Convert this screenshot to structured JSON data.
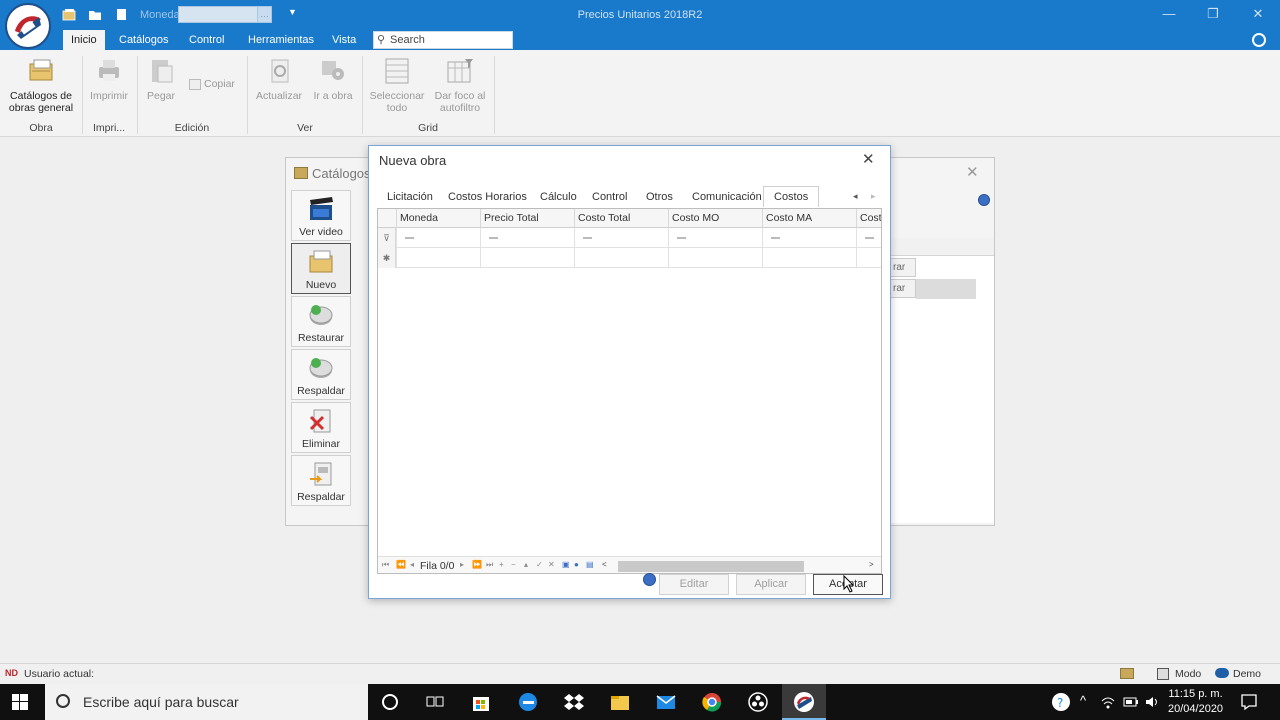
{
  "app": {
    "title": "Precios Unitarios 2018R2",
    "moneda_label": "Moneda"
  },
  "ribbon_tabs": [
    "Inicio",
    "Catálogos",
    "Control",
    "Herramientas",
    "Vista"
  ],
  "search_placeholder": "Search",
  "ribbon": {
    "obra_btn": "Catálogos de obras general",
    "imprimir_btn": "Imprimir",
    "pegar_btn": "Pegar",
    "copiar_btn": "Copiar",
    "actualizar_btn": "Actualizar",
    "ir_obra_btn": "Ir a obra",
    "seleccionar_btn": "Seleccionar todo",
    "dar_foco_btn": "Dar foco al autofiltro",
    "groups": [
      "Obra",
      "Impri...",
      "Edición",
      "Ver",
      "Grid"
    ]
  },
  "bg_window": {
    "title": "Catálogos",
    "side_buttons": [
      "Ver video",
      "Nuevo",
      "Restaurar",
      "Respaldar",
      "Eliminar",
      "Respaldar"
    ],
    "cell_buttons": [
      "rar",
      "rar"
    ]
  },
  "dialog": {
    "title": "Nueva obra",
    "tabs": [
      "Licitación",
      "Costos Horarios",
      "Cálculo",
      "Control",
      "Otros",
      "Comunicación",
      "Costos"
    ],
    "active_tab": "Costos",
    "columns": [
      "Moneda",
      "Precio Total",
      "Costo Total",
      "Costo MO",
      "Costo MA",
      "Costo"
    ],
    "nav_text": "Fila 0/0",
    "buttons": {
      "editar": "Editar",
      "aplicar": "Aplicar",
      "aceptar": "Aceptar"
    }
  },
  "statusbar": {
    "user_prefix": "ND",
    "user_label": "Usuario actual:",
    "modo": "Modo",
    "demo": "Demo"
  },
  "taskbar": {
    "search_placeholder": "Escribe aquí para buscar",
    "time": "11:15 p. m.",
    "date": "20/04/2020"
  }
}
